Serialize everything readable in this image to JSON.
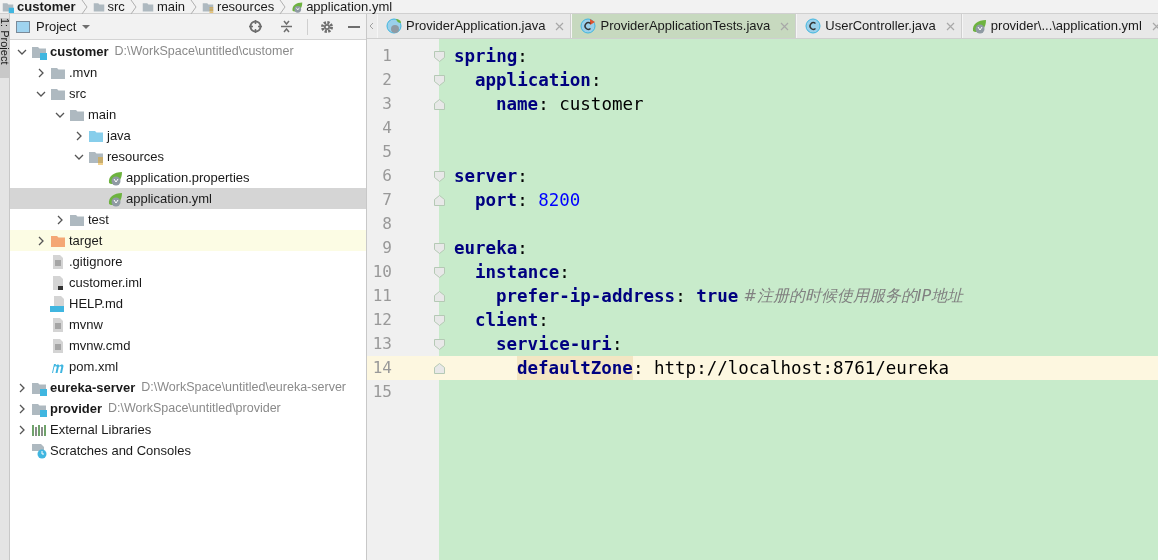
{
  "breadcrumbs": [
    {
      "label": "customer",
      "kind": "module"
    },
    {
      "label": "src",
      "kind": "folder"
    },
    {
      "label": "main",
      "kind": "folder"
    },
    {
      "label": "resources",
      "kind": "resources"
    },
    {
      "label": "application.yml",
      "kind": "spring"
    }
  ],
  "tool_strip": {
    "label": "1: Project"
  },
  "project_panel": {
    "view": "Project",
    "tree": [
      {
        "label": "customer",
        "path": "D:\\WorkSpace\\untitled\\customer",
        "kind": "module",
        "expanded": true,
        "selected": false,
        "children": [
          {
            "label": ".mvn",
            "kind": "folder",
            "expanded": false,
            "selected": false
          },
          {
            "label": "src",
            "kind": "folder",
            "expanded": true,
            "selected": false,
            "children": [
              {
                "label": "main",
                "kind": "folder",
                "expanded": true,
                "selected": false,
                "children": [
                  {
                    "label": "java",
                    "kind": "source",
                    "expanded": false,
                    "selected": false
                  },
                  {
                    "label": "resources",
                    "kind": "resources",
                    "expanded": true,
                    "selected": false,
                    "children": [
                      {
                        "label": "application.properties",
                        "kind": "spring",
                        "selected": false
                      },
                      {
                        "label": "application.yml",
                        "kind": "spring",
                        "selected": true
                      }
                    ]
                  }
                ]
              },
              {
                "label": "test",
                "kind": "folder",
                "expanded": false,
                "selected": false
              }
            ]
          },
          {
            "label": "target",
            "kind": "excluded",
            "expanded": false,
            "selected": false
          },
          {
            "label": ".gitignore",
            "kind": "text",
            "selected": false
          },
          {
            "label": "customer.iml",
            "kind": "iml",
            "selected": false
          },
          {
            "label": "HELP.md",
            "kind": "md",
            "selected": false
          },
          {
            "label": "mvnw",
            "kind": "text",
            "selected": false
          },
          {
            "label": "mvnw.cmd",
            "kind": "text",
            "selected": false
          },
          {
            "label": "pom.xml",
            "kind": "maven",
            "selected": false
          }
        ]
      },
      {
        "label": "eureka-server",
        "path": "D:\\WorkSpace\\untitled\\eureka-server",
        "kind": "module",
        "expanded": false,
        "selected": false
      },
      {
        "label": "provider",
        "path": "D:\\WorkSpace\\untitled\\provider",
        "kind": "module",
        "expanded": false,
        "selected": false
      },
      {
        "label": "External Libraries",
        "kind": "libraries",
        "expanded": false,
        "selected": false
      },
      {
        "label": "Scratches and Consoles",
        "kind": "scratches",
        "selected": false
      }
    ]
  },
  "editor": {
    "tabs": [
      {
        "label": "ProviderApplication.java",
        "kind": "spring-class",
        "color": "#e8e8e8"
      },
      {
        "label": "ProviderApplicationTests.java",
        "kind": "test-class",
        "color": "#c7d9bf"
      },
      {
        "label": "UserController.java",
        "kind": "class",
        "color": "#e8e8e8"
      },
      {
        "label": "provider\\...\\application.yml",
        "kind": "spring",
        "color": "#e8e8e8"
      }
    ],
    "lines": [
      {
        "number": "1",
        "current": false,
        "tokens": [
          {
            "kind": "key",
            "text": "spring"
          },
          {
            "kind": "colon",
            "text": ":"
          }
        ],
        "children": [
          {
            "number": "2",
            "current": false,
            "tokens": [
              {
                "kind": "key",
                "text": "application"
              },
              {
                "kind": "colon",
                "text": ":"
              }
            ],
            "children": [
              {
                "number": "3",
                "current": false,
                "tokens": [
                  {
                    "kind": "key",
                    "text": "name"
                  },
                  {
                    "kind": "colon",
                    "text": ":"
                  },
                  {
                    "kind": "plain",
                    "text": " customer"
                  }
                ]
              }
            ]
          }
        ]
      },
      {
        "number": "4",
        "current": false
      },
      {
        "number": "5",
        "current": false
      },
      {
        "number": "6",
        "current": false,
        "tokens": [
          {
            "kind": "key",
            "text": "server"
          },
          {
            "kind": "colon",
            "text": ":"
          }
        ],
        "children": [
          {
            "number": "7",
            "current": false,
            "tokens": [
              {
                "kind": "key",
                "text": "port"
              },
              {
                "kind": "colon",
                "text": ":"
              },
              {
                "kind": "number",
                "text": " 8200"
              }
            ]
          }
        ]
      },
      {
        "number": "8",
        "current": false
      },
      {
        "number": "9",
        "current": false,
        "tokens": [
          {
            "kind": "key",
            "text": "eureka"
          },
          {
            "kind": "colon",
            "text": ":"
          }
        ],
        "children": [
          {
            "number": "10",
            "current": false,
            "tokens": [
              {
                "kind": "key",
                "text": "instance"
              },
              {
                "kind": "colon",
                "text": ":"
              }
            ],
            "children": [
              {
                "number": "11",
                "current": false,
                "tokens": [
                  {
                    "kind": "key",
                    "text": "prefer-ip-address"
                  },
                  {
                    "kind": "colon",
                    "text": ":"
                  },
                  {
                    "kind": "keyword",
                    "text": " true"
                  },
                  {
                    "kind": "comment",
                    "text": " #注册的时候使用服务的IP地址"
                  }
                ]
              }
            ]
          },
          {
            "number": "12",
            "current": false,
            "tokens": [
              {
                "kind": "key",
                "text": "client"
              },
              {
                "kind": "colon",
                "text": ":"
              }
            ],
            "children": [
              {
                "number": "13",
                "current": false,
                "tokens": [
                  {
                    "kind": "key",
                    "text": "service-uri"
                  },
                  {
                    "kind": "colon",
                    "text": ":"
                  }
                ],
                "children": [
                  {
                    "number": "14",
                    "current": true,
                    "tokens": [
                      {
                        "kind": "key-marked",
                        "text": "defaultZone"
                      },
                      {
                        "kind": "colon",
                        "text": ":"
                      },
                      {
                        "kind": "plain",
                        "text": " http://localhost:8761/eureka"
                      }
                    ]
                  }
                ]
              }
            ]
          }
        ]
      },
      {
        "number": "15",
        "current": false
      }
    ]
  }
}
